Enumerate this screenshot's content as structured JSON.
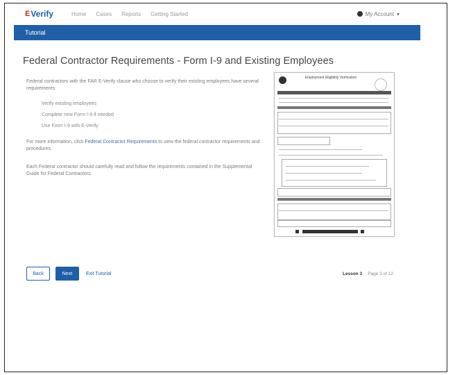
{
  "header": {
    "logo": {
      "mark": "E",
      "text": "Verify"
    },
    "nav": [
      "Home",
      "Cases",
      "Reports",
      "Getting Started"
    ],
    "account_label": "My Account"
  },
  "banner": {
    "title": "Tutorial"
  },
  "main": {
    "title": "Federal Contractor Requirements - Form I-9 and Existing Employees",
    "intro": "Federal contractors with the FAR E-Verify clause who choose to verify their existing employees have several requirements:",
    "requirements": [
      "Verify existing employees",
      "Complete new Form I-9 if needed",
      "Use Form I-9 with E-Verify"
    ],
    "para2_prefix": "For more information, click ",
    "para2_link": "Federal Contractor Requirements",
    "para2_suffix": " to view the federal contractor requirements and procedures.",
    "para3": "Each Federal contractor should carefully read and follow the requirements contained in the Supplemental Guide for Federal Contractors."
  },
  "doc_preview": {
    "heading": "Employment Eligibility Verification"
  },
  "footer": {
    "back_label": "Back",
    "next_label": "Next",
    "exit_label": "Exit Tutorial",
    "lesson_label": "Lesson 3",
    "page_label": "Page 3 of 12"
  },
  "colors": {
    "primary": "#1f5fa7",
    "logo_accent": "#c62828"
  }
}
